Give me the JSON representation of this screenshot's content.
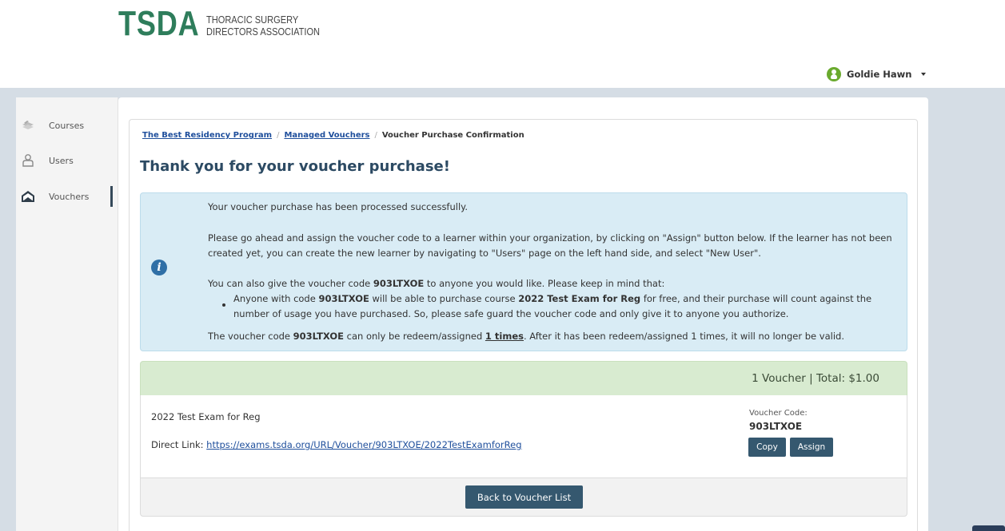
{
  "header": {
    "logo_mark": "TSDA",
    "logo_line1": "THORACIC SURGERY",
    "logo_line2": "DIRECTORS ASSOCIATION",
    "user_name": "Goldie Hawn"
  },
  "sidebar": {
    "items": [
      {
        "label": "Courses",
        "icon": "courses-icon"
      },
      {
        "label": "Users",
        "icon": "user-icon"
      },
      {
        "label": "Vouchers",
        "icon": "voucher-icon",
        "active": true
      }
    ]
  },
  "breadcrumb": {
    "item1": "The Best Residency Program",
    "item2": "Managed Vouchers",
    "current": "Voucher Purchase Confirmation",
    "separator": "/"
  },
  "page_title": "Thank you for your voucher purchase!",
  "info": {
    "line1": "Your voucher purchase has been processed successfully.",
    "line2": "Please go ahead and assign the voucher code to a learner within your organization, by clicking on \"Assign\" button below. If the learner has not been",
    "line3": "created yet, you can create the new learner by navigating to \"Users\" page on the left hand side, and select \"New User\".",
    "line4_pre": "You can also give the voucher code ",
    "line4_post": " to anyone you would like. Please keep in mind that:",
    "bullet_pre": "Anyone with code ",
    "bullet_mid": " will be able to purchase course ",
    "bullet_course": "2022 Test Exam for Reg",
    "bullet_post": " for free, and their purchase will count against the",
    "bullet_line2": "number of usage you have purchased. So, please safe guard the voucher code and only give it to anyone you authorize.",
    "line5_pre": "The voucher code ",
    "line5_mid": " can only be redeem/assigned ",
    "line5_times": "1 times",
    "line5_post": ". After it has been redeem/assigned 1 times, it will no longer be valid.",
    "code": "903LTXOE"
  },
  "summary": {
    "total_text": "1 Voucher | Total: $1.00"
  },
  "voucher": {
    "course_name": "2022 Test Exam for Reg",
    "direct_link_label": "Direct Link: ",
    "direct_link_url": "https://exams.tsda.org/URL/Voucher/903LTXOE/2022TestExamforReg",
    "code_label": "Voucher Code:",
    "code": "903LTXOE",
    "copy_label": "Copy",
    "assign_label": "Assign"
  },
  "footer": {
    "back_label": "Back to Voucher List"
  },
  "colors": {
    "brand_green": "#2e7d5b",
    "title_blue": "#2c4a63",
    "button": "#35586f",
    "info_bg": "#d9ecf5",
    "summary_bg": "#d8ebd0",
    "page_bg": "#d5dde5"
  }
}
